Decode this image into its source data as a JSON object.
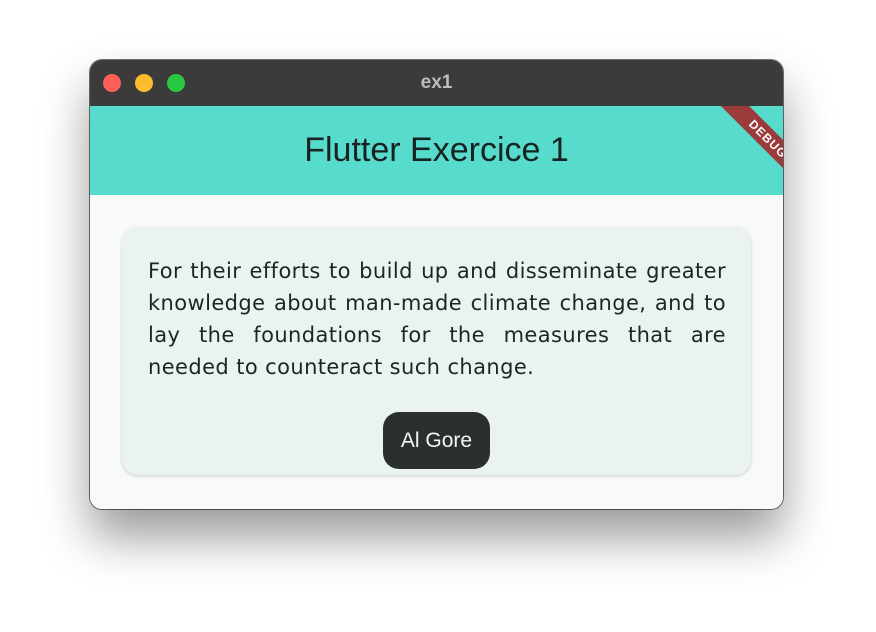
{
  "window": {
    "title": "ex1"
  },
  "appbar": {
    "title": "Flutter Exercice 1",
    "color": "#57dbcc"
  },
  "debug_banner": {
    "label": "DEBUG"
  },
  "card": {
    "quote": "For their efforts to build up and disseminate greater knowledge about man-made climate change, and to lay the foundations for the measures that are needed to counteract such change.",
    "button_label": "Al Gore"
  },
  "colors": {
    "titlebar": "#3b3b3b",
    "close": "#fe5f57",
    "minimize": "#febc2e",
    "maximize": "#28c840",
    "card_background": "#ebf3f2",
    "button_background": "#2a302f"
  },
  "icons": [
    "close-traffic-light",
    "minimize-traffic-light",
    "maximize-traffic-light"
  ]
}
